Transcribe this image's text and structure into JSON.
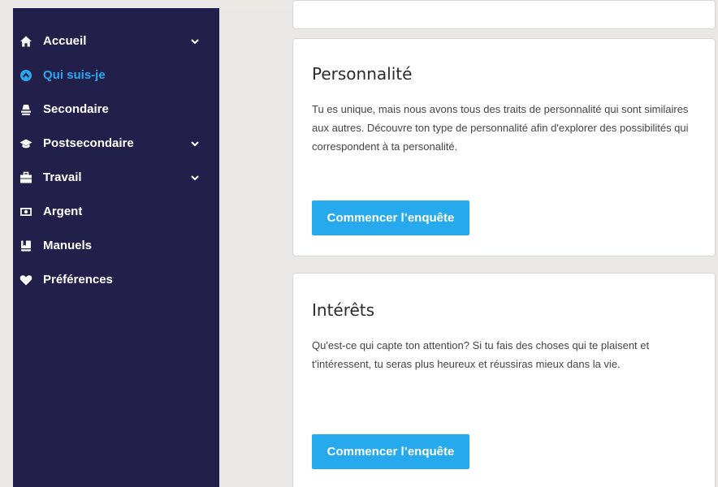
{
  "sidebar": {
    "items": [
      {
        "label": "Accueil",
        "icon": "home-icon",
        "has_chevron": true,
        "active": false
      },
      {
        "label": "Qui suis-je",
        "icon": "circle-arrow-up-icon",
        "has_chevron": false,
        "active": true
      },
      {
        "label": "Secondaire",
        "icon": "school-icon",
        "has_chevron": false,
        "active": false
      },
      {
        "label": "Postsecondaire",
        "icon": "graduation-cap-icon",
        "has_chevron": true,
        "active": false
      },
      {
        "label": "Travail",
        "icon": "briefcase-icon",
        "has_chevron": true,
        "active": false
      },
      {
        "label": "Argent",
        "icon": "money-icon",
        "has_chevron": false,
        "active": false
      },
      {
        "label": "Manuels",
        "icon": "book-icon",
        "has_chevron": false,
        "active": false
      },
      {
        "label": "Préférences",
        "icon": "heart-icon",
        "has_chevron": false,
        "active": false
      }
    ]
  },
  "cards": [
    {
      "title": "Personnalité",
      "text": "Tu es unique, mais nous avons tous des traits de personnalité qui sont similaires aux autres. Découvre ton type de personnalité afin d'explorer des possibilités qui correspondent à ta personalité.",
      "button": "Commencer l’enquête"
    },
    {
      "title": "Intérêts",
      "text": "Qu'est-ce qui capte ton attention? Si tu fais des choses qui te plaisent et t'intéressent, tu seras plus heureux et réussiras mieux dans la vie.",
      "button": "Commencer l’enquête"
    }
  ],
  "colors": {
    "sidebar_bg": "#22204b",
    "active": "#29a8f0",
    "button": "#27a9ee"
  }
}
